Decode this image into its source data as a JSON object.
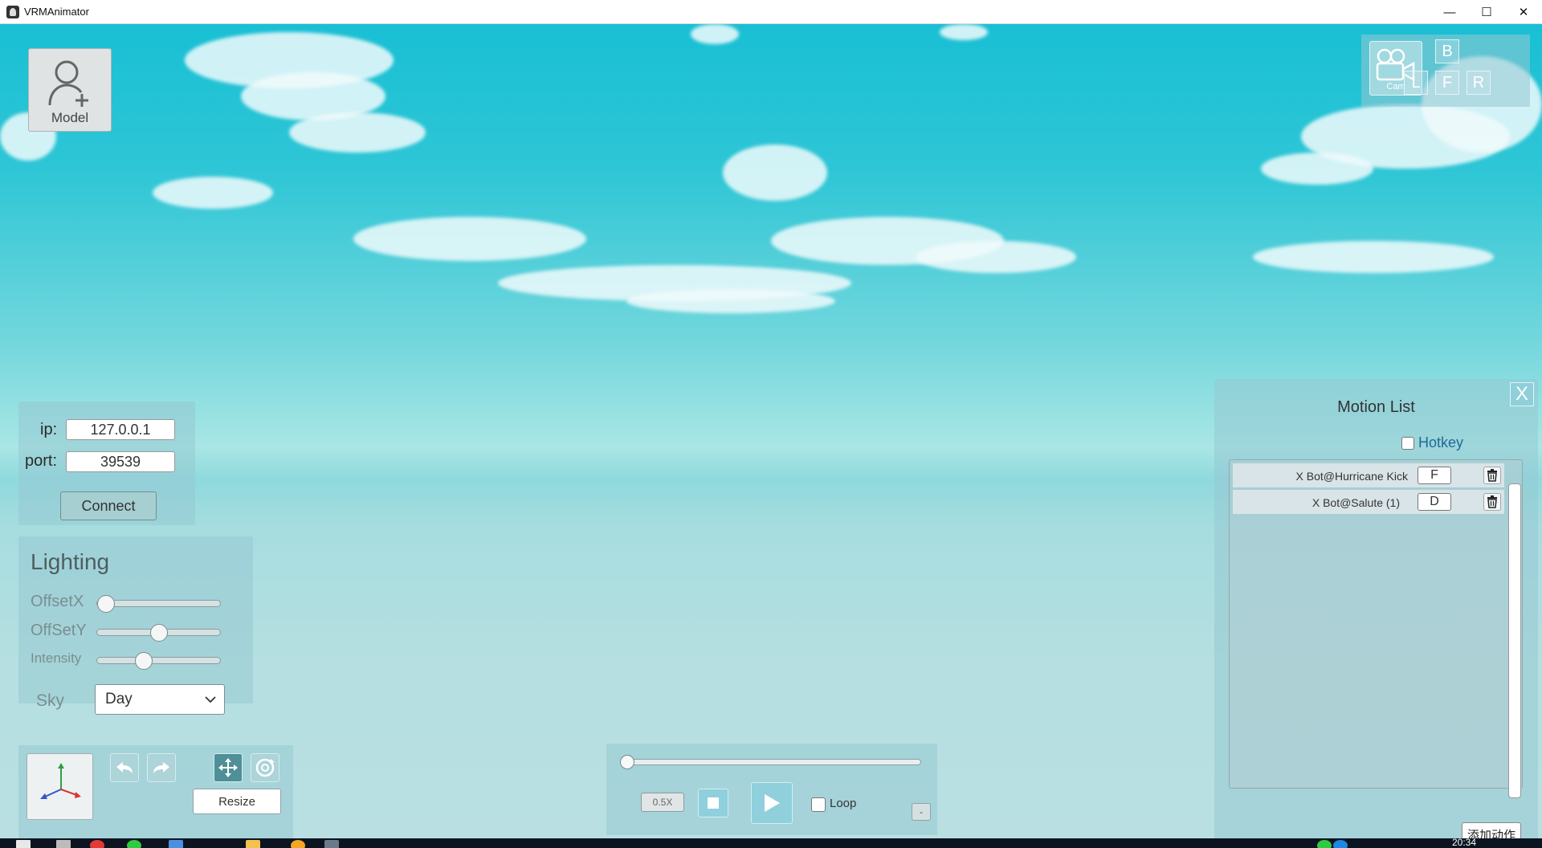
{
  "window": {
    "title": "VRMAnimator",
    "minimize": "—",
    "maximize": "☐",
    "close": "✕"
  },
  "model_button": {
    "label": "Model",
    "icon": "add-user-icon"
  },
  "camera": {
    "cam_label": "Cam",
    "views": {
      "back": "B",
      "left": "L",
      "front": "F",
      "right": "R"
    }
  },
  "connection": {
    "ip_label": "ip:",
    "ip_value": "127.0.0.1",
    "port_label": "port:",
    "port_value": "39539",
    "connect_label": "Connect"
  },
  "lighting": {
    "title": "Lighting",
    "sliders": [
      {
        "label": "OffsetX",
        "value": 0.0
      },
      {
        "label": "OffSetY",
        "value": 0.5
      },
      {
        "label": "Intensity",
        "value": 0.38
      }
    ],
    "sky_label": "Sky",
    "sky_value": "Day"
  },
  "tools": {
    "axis_label": "Axis",
    "resize_label": "Resize"
  },
  "playback": {
    "speed_label": "0.5X",
    "loop_label": "Loop",
    "loop_checked": false,
    "progress": 0.0,
    "mini_label": "-"
  },
  "motion_list": {
    "title": "Motion List",
    "close_label": "X",
    "hotkey_label": "Hotkey",
    "hotkey_checked": false,
    "items": [
      {
        "name": "X Bot@Hurricane Kick",
        "key": "F"
      },
      {
        "name": "X Bot@Salute (1)",
        "key": "D"
      }
    ],
    "add_label": "添加动作"
  },
  "taskbar": {
    "time": "20:34"
  },
  "colors": {
    "sky_top": "#19bfd4",
    "panel": "#96c8d2",
    "accent_blue": "#1f6a9c"
  }
}
